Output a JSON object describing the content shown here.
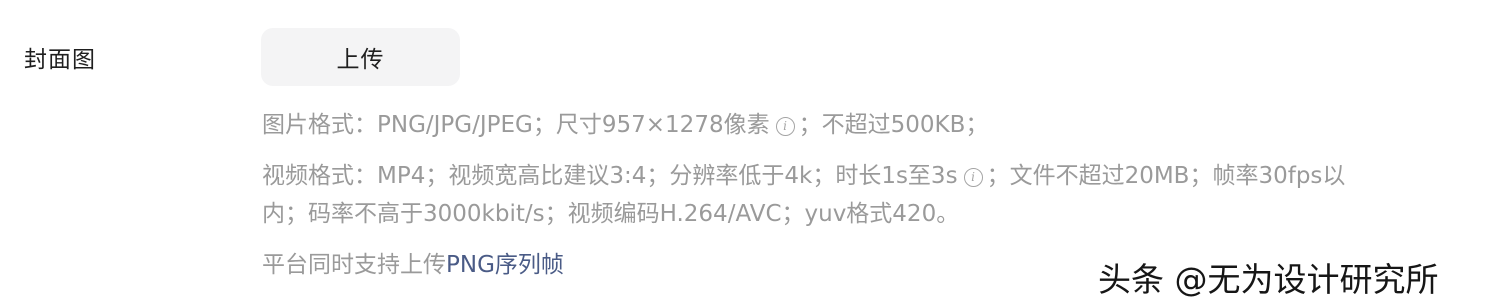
{
  "form": {
    "cover_label": "封面图",
    "upload_button_label": "上传"
  },
  "hints": {
    "image_before_icon": "图片格式：PNG/JPG/JPEG；尺寸957×1278像素",
    "image_after_icon": "；不超过500KB；",
    "video_line1_before_icon": "视频格式：MP4；视频宽高比建议3:4；分辨率低于4k；时长1s至3s",
    "video_line1_after_icon": "；文件不超过20MB；帧率30fps以",
    "video_line2": "内；码率不高于3000kbit/s；视频编码H.264/AVC；yuv格式420。",
    "platform_prefix": "平台同时支持上传",
    "platform_link": "PNG序列帧",
    "info_glyph": "i"
  },
  "watermark": "头条 @无为设计研究所",
  "colors": {
    "label": "#1f1f1f",
    "hint": "#9a9a9a",
    "link": "#4a5b86",
    "button_bg": "#f4f4f5"
  },
  "icons": {
    "info": "info-circle-icon"
  }
}
